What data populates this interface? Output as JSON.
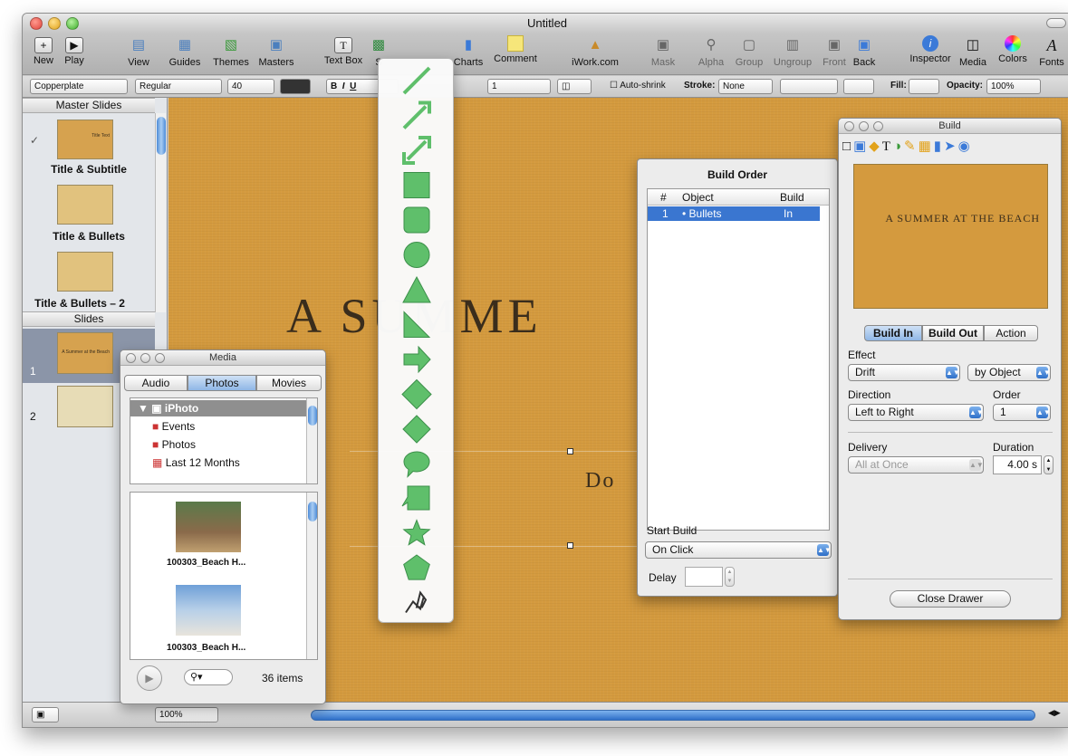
{
  "window": {
    "title": "Untitled"
  },
  "toolbar": {
    "new": "New",
    "play": "Play",
    "view": "View",
    "guides": "Guides",
    "themes": "Themes",
    "masters": "Masters",
    "textbox": "Text Box",
    "shapes_partial": "S",
    "charts": "Charts",
    "comment": "Comment",
    "iwork": "iWork.com",
    "mask": "Mask",
    "alpha": "Alpha",
    "group": "Group",
    "ungroup": "Ungroup",
    "front": "Front",
    "back": "Back",
    "inspector": "Inspector",
    "media": "Media",
    "colors": "Colors",
    "fonts": "Fonts"
  },
  "format_bar": {
    "font": "Copperplate",
    "style": "Regular",
    "size": "40",
    "spacing": "1",
    "autoshrink": "Auto-shrink",
    "stroke_label": "Stroke:",
    "stroke_value": "None",
    "fill_label": "Fill:",
    "opacity_label": "Opacity:",
    "opacity_value": "100%"
  },
  "sidebar": {
    "master_header": "Master Slides",
    "masters": [
      "Title & Subtitle",
      "Title & Bullets",
      "Title & Bullets – 2"
    ],
    "slides_header": "Slides",
    "slide_numbers": [
      "1",
      "2"
    ],
    "thumb_text": "Title Text",
    "slide_thumb_text": "A Summer at the Beach"
  },
  "canvas": {
    "title": "A SUMME",
    "subtitle": "Do"
  },
  "bottom": {
    "zoom": "100%"
  },
  "media_panel": {
    "title": "Media",
    "tabs": [
      "Audio",
      "Photos",
      "Movies"
    ],
    "active_tab": "Photos",
    "sources": [
      "iPhoto",
      "Events",
      "Photos",
      "Last 12 Months"
    ],
    "photos": [
      "100303_Beach H...",
      "100303_Beach H..."
    ],
    "count": "36 items"
  },
  "build_order": {
    "title": "Build Order",
    "columns": [
      "#",
      "Object",
      "Build"
    ],
    "rows": [
      {
        "num": "1",
        "object": "• Bullets",
        "build": "In"
      }
    ],
    "start_build_label": "Start Build",
    "start_build_value": "On Click",
    "delay_label": "Delay"
  },
  "build_inspector": {
    "title": "Build",
    "preview_text": "A SUMMER AT THE BEACH",
    "tabs": [
      "Build In",
      "Build Out",
      "Action"
    ],
    "active_tab": "Build In",
    "effect_label": "Effect",
    "effect_value": "Drift",
    "effect_by": "by Object",
    "direction_label": "Direction",
    "direction_value": "Left to Right",
    "order_label": "Order",
    "order_value": "1",
    "delivery_label": "Delivery",
    "delivery_value": "All at Once",
    "duration_label": "Duration",
    "duration_value": "4.00 s",
    "close_button": "Close Drawer"
  },
  "shapes_menu": [
    "line",
    "arrow-line",
    "double-arrow-line",
    "rectangle",
    "rounded-rectangle",
    "circle",
    "triangle",
    "right-triangle",
    "arrow",
    "double-arrow",
    "diamond",
    "speech-bubble",
    "callout",
    "star",
    "pentagon",
    "pen-tool"
  ],
  "colors": {
    "accent_blue": "#2e6fc8",
    "canvas_orange": "#d49a3e",
    "shape_green": "#5fbf6b"
  }
}
